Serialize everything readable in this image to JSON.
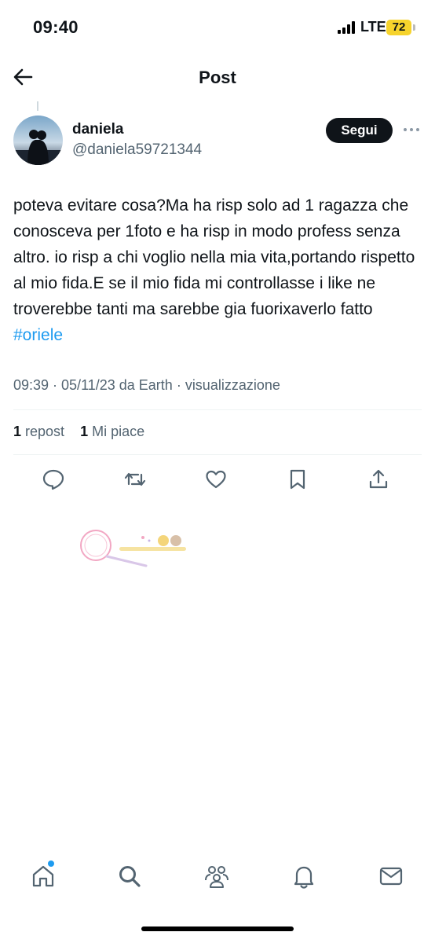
{
  "status_bar": {
    "time": "09:40",
    "network": "LTE",
    "battery": "72"
  },
  "header": {
    "title": "Post",
    "back_icon": "arrow-left-icon"
  },
  "post": {
    "author_name": "daniela",
    "author_handle": "@daniela59721344",
    "follow_label": "Segui",
    "text": "poteva evitare cosa?Ma ha risp solo ad 1 ragazza che conosceva per 1foto e ha risp in modo profess senza altro. io risp a chi voglio nella mia vita,portando rispetto al mio fida.E se il mio fida mi controllasse i like ne troverebbe tanti ma sarebbe gia fuorixaverlo fatto ",
    "hashtag": "#oriele",
    "meta": "09:39 · 05/11/23 da Earth · visualizzazione",
    "reposts_count": "1",
    "reposts_label": "repost",
    "likes_count": "1",
    "likes_label": "Mi piace"
  },
  "actions": [
    "reply-icon",
    "repost-icon",
    "like-icon",
    "bookmark-icon",
    "share-icon"
  ],
  "tabbar": [
    "home-icon",
    "search-icon",
    "communities-icon",
    "notifications-icon",
    "messages-icon"
  ],
  "colors": {
    "accent": "#1d9bf0",
    "text": "#0f1419",
    "secondary": "#536471",
    "follow_bg": "#0f1419",
    "battery": "#f6d32c"
  }
}
